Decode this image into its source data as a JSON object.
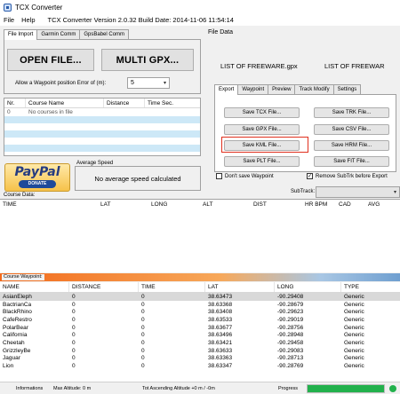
{
  "window": {
    "title": "TCX Converter"
  },
  "menu": {
    "file": "File",
    "help": "Help",
    "version": "TCX Converter Version 2.0.32 Build Date: 2014-11-06 11:54:14"
  },
  "left_tabs": [
    "File Import",
    "Garmin Comm",
    "GpsBabel Comm"
  ],
  "import": {
    "open_label": "OPEN FILE...",
    "multi_label": "MULTI GPX...",
    "waypoint_error_label": "Allow a Waypoint position Error of (m):",
    "waypoint_error_value": "5"
  },
  "courses": {
    "columns": [
      "Nr.",
      "Course Name",
      "Distance",
      "Time Sec."
    ],
    "row": {
      "nr": "0",
      "name": "No courses in file"
    }
  },
  "paypal": {
    "logo": "PayPal",
    "donate": "DONATE"
  },
  "avg_speed": {
    "title": "Average Speed",
    "text": "No average speed calculated"
  },
  "file_data": {
    "title": "File Data",
    "name1": "LIST OF FREEWARE.gpx",
    "name2": "LIST OF FREEWAR"
  },
  "right_tabs": [
    "Export",
    "Waypoint",
    "Preview",
    "Track Modify",
    "Settings"
  ],
  "export": {
    "left": [
      "Save TCX File...",
      "Save GPX File...",
      "Save KML File...",
      "Save PLT File..."
    ],
    "right": [
      "Save TRK File...",
      "Save CSV File...",
      "Save HRM File...",
      "Save FIT File..."
    ],
    "dont_save_waypoint": "Don't save Waypoint",
    "remove_subtrk": "Remove SubTrk before Export",
    "highlight_color": "#e0301e"
  },
  "subtrack": {
    "label": "SubTrack:"
  },
  "course_data": {
    "title": "Course Data:",
    "columns": [
      "TIME",
      "LAT",
      "LONG",
      "ALT",
      "DIST",
      "HR BPM",
      "CAD",
      "AVG"
    ]
  },
  "course_waypoint": {
    "title": "Course Waypoint:",
    "columns": [
      "NAME",
      "DISTANCE",
      "TIME",
      "LAT",
      "LONG",
      "TYPE"
    ],
    "rows": [
      [
        "AsianEleph",
        "0",
        "0",
        "38.63473",
        "-90.29408",
        "Generic"
      ],
      [
        "BactrianCa",
        "0",
        "0",
        "38.63368",
        "-90.28679",
        "Generic"
      ],
      [
        "BlackRhino",
        "0",
        "0",
        "38.63408",
        "-90.29623",
        "Generic"
      ],
      [
        "CafeRestro",
        "0",
        "0",
        "38.63533",
        "-90.29019",
        "Generic"
      ],
      [
        "PolarBear",
        "0",
        "0",
        "38.63677",
        "-90.28756",
        "Generic"
      ],
      [
        "California",
        "0",
        "0",
        "38.63496",
        "-90.28948",
        "Generic"
      ],
      [
        "Cheetah",
        "0",
        "0",
        "38.63421",
        "-90.29458",
        "Generic"
      ],
      [
        "GrizzleyBe",
        "0",
        "0",
        "38.63633",
        "-90.29083",
        "Generic"
      ],
      [
        "Jaguar",
        "0",
        "0",
        "38.63363",
        "-90.28713",
        "Generic"
      ],
      [
        "Lion",
        "0",
        "0",
        "38.63347",
        "-90.28769",
        "Generic"
      ]
    ]
  },
  "status": {
    "informations": "Informations",
    "max_altitude": "Max Altitude: 0 m",
    "ascending": "Tot Ascending Altitude +0 m / -0m",
    "progress_label": "Progress",
    "progress_value": 1.0,
    "progress_color": "#22b14c"
  }
}
